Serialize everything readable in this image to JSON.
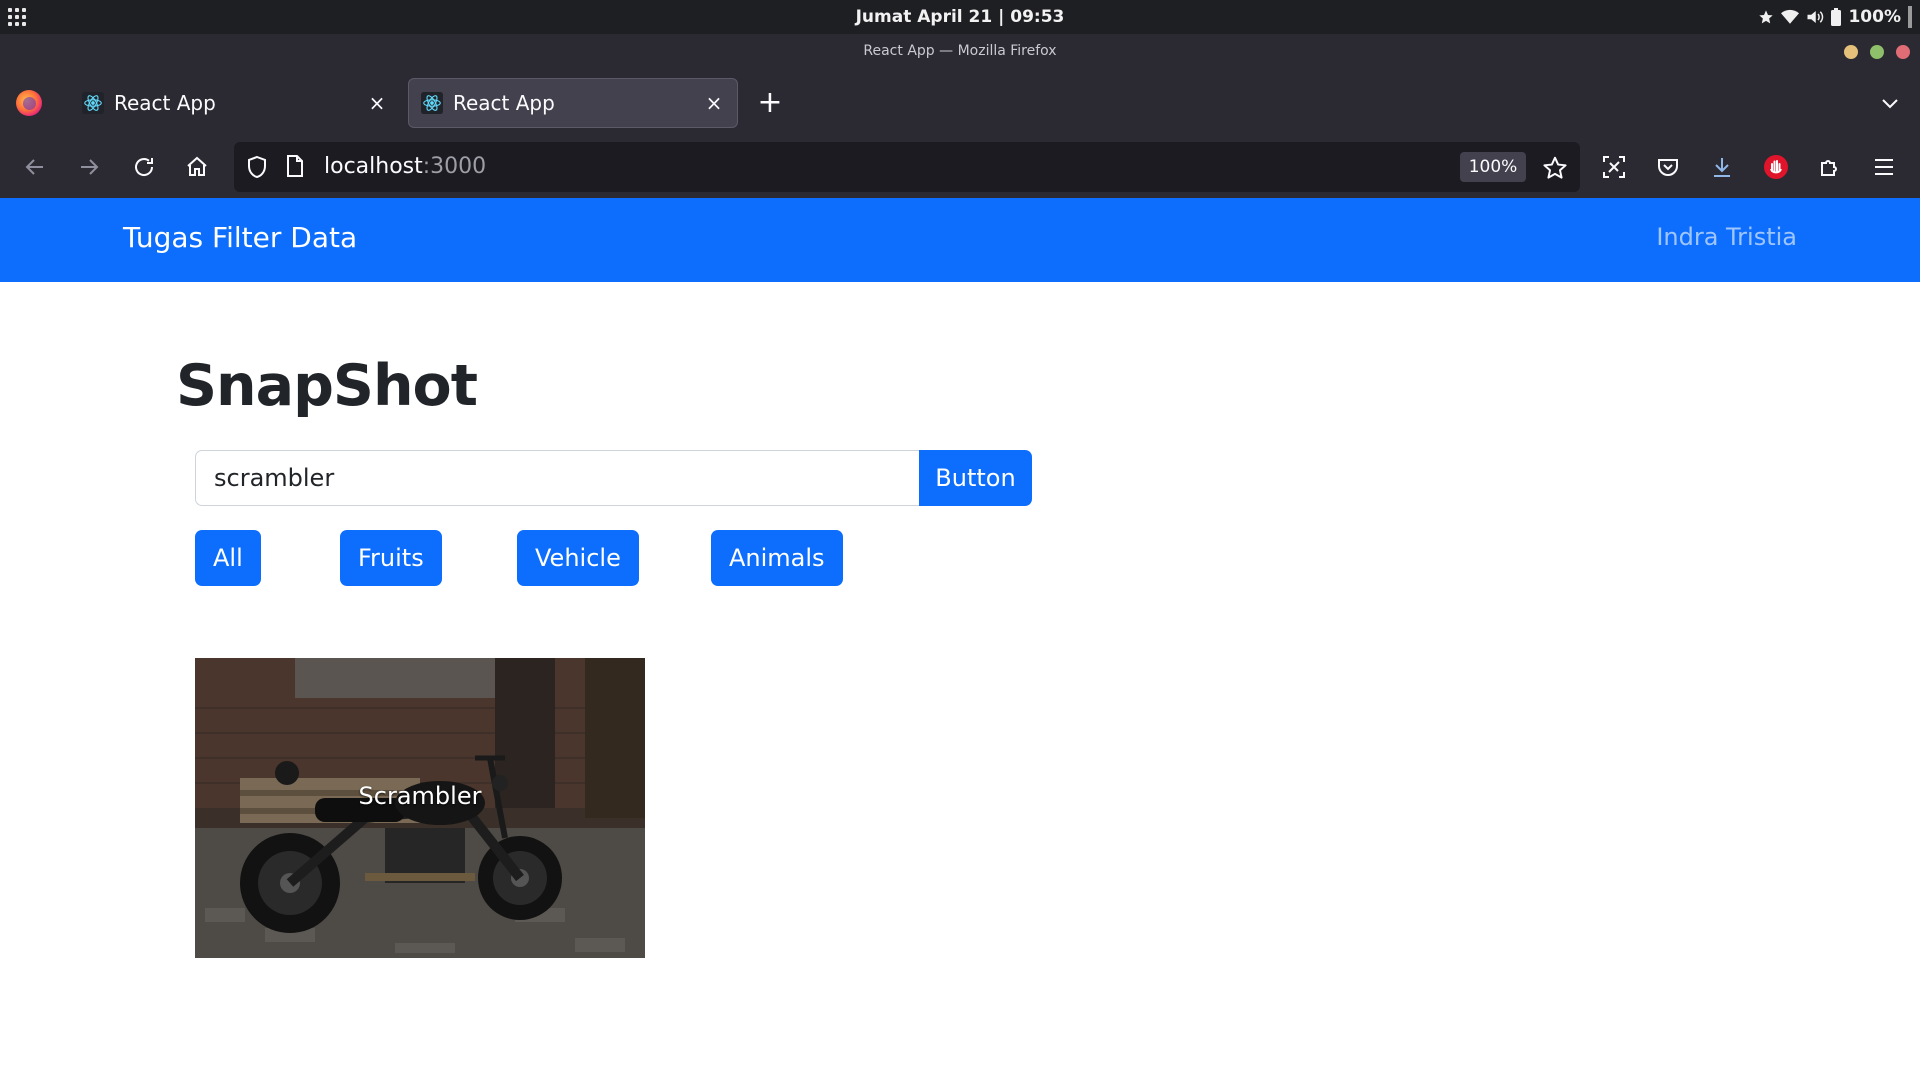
{
  "os": {
    "clock": "Jumat April 21 | 09:53",
    "battery": "100%"
  },
  "window": {
    "title": "React App — Mozilla Firefox"
  },
  "tabs": [
    {
      "label": "React App",
      "active": false
    },
    {
      "label": "React App",
      "active": true
    }
  ],
  "nav": {
    "url_host": "localhost",
    "url_port": ":3000",
    "zoom": "100%"
  },
  "app": {
    "brand": "Tugas Filter Data",
    "user": "Indra Tristia",
    "heading": "SnapShot",
    "search": {
      "value": "scrambler",
      "button": "Button"
    },
    "filters": [
      "All",
      "Fruits",
      "Vehicle",
      "Animals"
    ],
    "results": [
      {
        "caption": "Scrambler"
      }
    ]
  },
  "colors": {
    "primary": "#0d6efd",
    "chrome": "#2b2a33",
    "os_bar": "#1e1f22"
  }
}
